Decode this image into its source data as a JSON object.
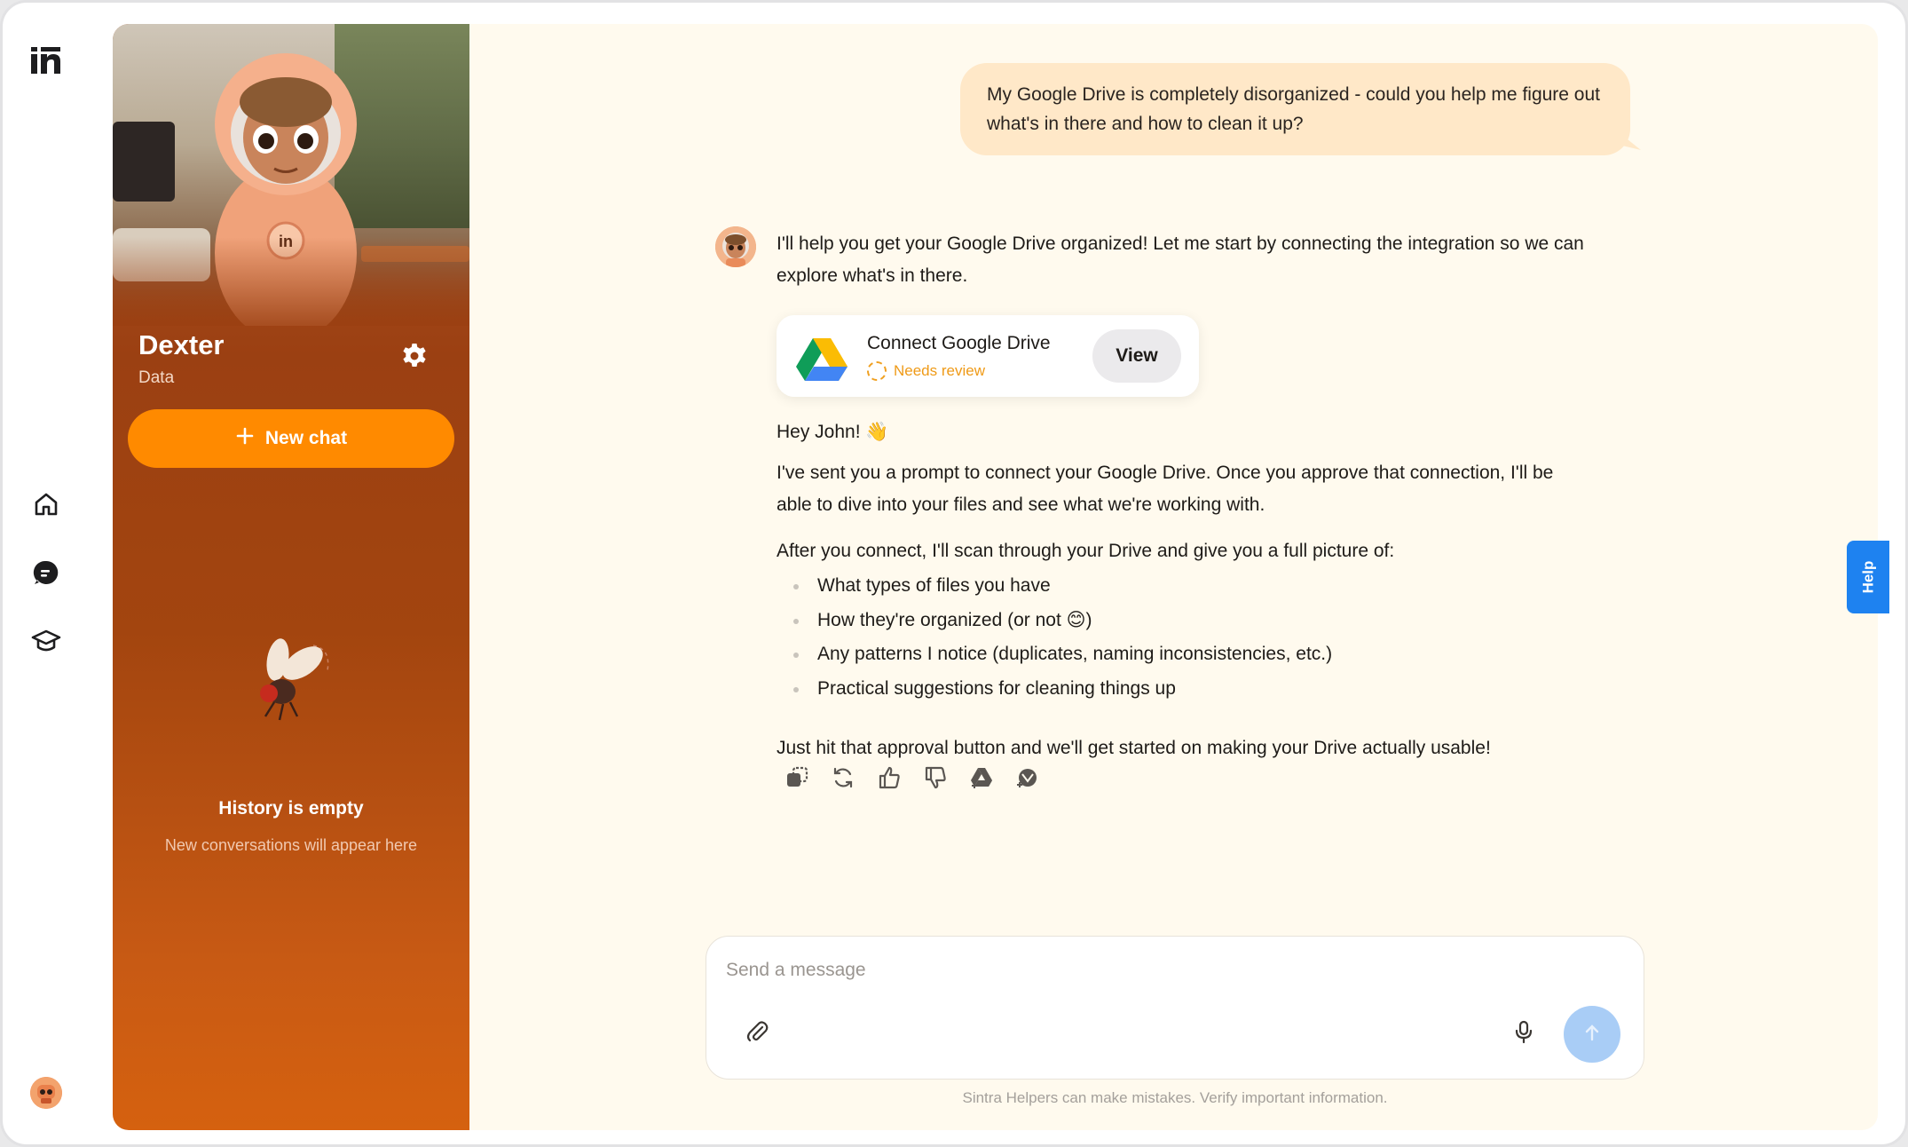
{
  "app": {
    "logo_text": "in"
  },
  "rail": {
    "items": [
      {
        "name": "home",
        "icon": "home-icon"
      },
      {
        "name": "chats",
        "icon": "chat-icon"
      },
      {
        "name": "learn",
        "icon": "graduation-cap-icon"
      }
    ]
  },
  "agent": {
    "name": "Dexter",
    "role": "Data",
    "new_chat_label": "New chat",
    "history_title": "History is empty",
    "history_subtitle": "New conversations will appear here"
  },
  "conversation": {
    "user_message": "My Google Drive is completely disorganized - could you help me figure out what's in there and how to clean it up?",
    "bot_intro": "I'll help you get your Google Drive organized! Let me start by connecting the integration so we can explore what's in there.",
    "integration_card": {
      "title": "Connect Google Drive",
      "status": "Needs review",
      "view_label": "View"
    },
    "bot_greeting": "Hey John! 👋",
    "bot_p2": "I've sent you a prompt to connect your Google Drive. Once you approve that connection, I'll be able to dive into your files and see what we're working with.",
    "bot_p3": "After you connect, I'll scan through your Drive and give you a full picture of:",
    "bot_list": [
      "What types of files you have",
      "How they're organized (or not 😊)",
      "Any patterns I notice (duplicates, naming inconsistencies, etc.)",
      "Practical suggestions for cleaning things up"
    ],
    "bot_p4": "Just hit that approval button and we'll get started on making your Drive actually usable!"
  },
  "message_actions": [
    "copy-icon",
    "regenerate-icon",
    "thumbs-up-icon",
    "thumbs-down-icon",
    "google-drive-icon",
    "integration-icon"
  ],
  "composer": {
    "placeholder": "Send a message",
    "disclaimer": "Sintra Helpers can make mistakes. Verify important information."
  },
  "help_tab": {
    "label": "Help"
  },
  "colors": {
    "accent": "#ff8a00",
    "panel_dark": "#9b4012",
    "main_bg": "#fffaee",
    "user_bubble": "#ffe8c8",
    "status_orange": "#ef9a17",
    "help_blue": "#1e82f0",
    "send_disabled": "#a9cdf6"
  }
}
